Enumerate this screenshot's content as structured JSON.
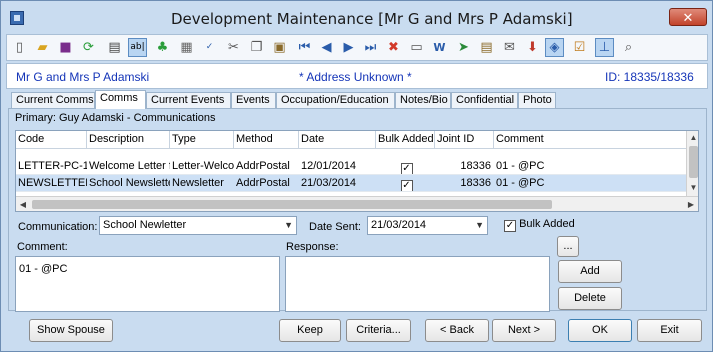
{
  "window": {
    "title": "Development Maintenance  [Mr G and Mrs P Adamski]",
    "close_label": "✕"
  },
  "toolbar": {
    "icons": [
      "new-document-icon",
      "open-folder-icon",
      "save-icon",
      "refresh-icon",
      "print-icon",
      "text-field-icon",
      "tree-icon",
      "calculator-icon",
      "spell-check-icon",
      "cut-icon",
      "copy-icon",
      "paste-icon",
      "first-record-icon",
      "previous-record-icon",
      "next-record-icon",
      "last-record-icon",
      "delete-icon",
      "card-icon",
      "word-document-icon",
      "forward-arrow-icon",
      "clipboard-icon",
      "mail-edit-icon",
      "download-icon",
      "tag-icon",
      "checklist-icon",
      "pin-icon",
      "search-document-icon"
    ]
  },
  "contact": {
    "name": "Mr G and Mrs P Adamski",
    "status": "* Address Unknown *",
    "id_label": "ID: 18335/18336"
  },
  "tabs": [
    {
      "label": "Current Comms",
      "active": false
    },
    {
      "label": "Comms",
      "active": true
    },
    {
      "label": "Current Events",
      "active": false
    },
    {
      "label": "Events",
      "active": false
    },
    {
      "label": "Occupation/Education",
      "active": false
    },
    {
      "label": "Notes/Bio",
      "active": false
    },
    {
      "label": "Confidential",
      "active": false
    },
    {
      "label": "Photo",
      "active": false
    }
  ],
  "comms": {
    "primary_label": "Primary: Guy Adamski - Communications",
    "columns": [
      "Code",
      "Description",
      "Type",
      "Method",
      "Date",
      "Bulk Added",
      "Joint ID",
      "Comment"
    ],
    "rows": [
      {
        "code": "LETTER-PC-1",
        "description": "Welcome Letter f",
        "type": "Letter-Welco",
        "method": "AddrPostal",
        "date": "12/01/2014",
        "bulk_added": true,
        "joint_id": "18336",
        "comment": "01 - @PC"
      },
      {
        "code": "NEWSLETTER",
        "description": "School Newsletter",
        "type": "Newsletter",
        "method": "AddrPostal",
        "date": "21/03/2014",
        "bulk_added": true,
        "joint_id": "18336",
        "comment": "01 - @PC"
      }
    ],
    "selected_row": 1
  },
  "form": {
    "communication_label": "Communication:",
    "communication_value": "School Newletter",
    "date_sent_label": "Date Sent:",
    "date_sent_value": "21/03/2014",
    "bulk_added_label": "Bulk Added",
    "bulk_added_checked": true,
    "comment_label": "Comment:",
    "comment_value": "01 - @PC",
    "response_label": "Response:",
    "response_value": "",
    "ellipsis_label": "...",
    "add_label": "Add",
    "delete_label": "Delete"
  },
  "buttons": {
    "show_spouse": "Show Spouse",
    "keep": "Keep",
    "criteria": "Criteria...",
    "back": "< Back",
    "next": "Next >",
    "ok": "OK",
    "exit": "Exit"
  },
  "colors": {
    "window_bg": "#c9dcf0",
    "contact_text": "#1535b8",
    "selected_row": "#cde0f5",
    "close_button": "#c2432b"
  }
}
